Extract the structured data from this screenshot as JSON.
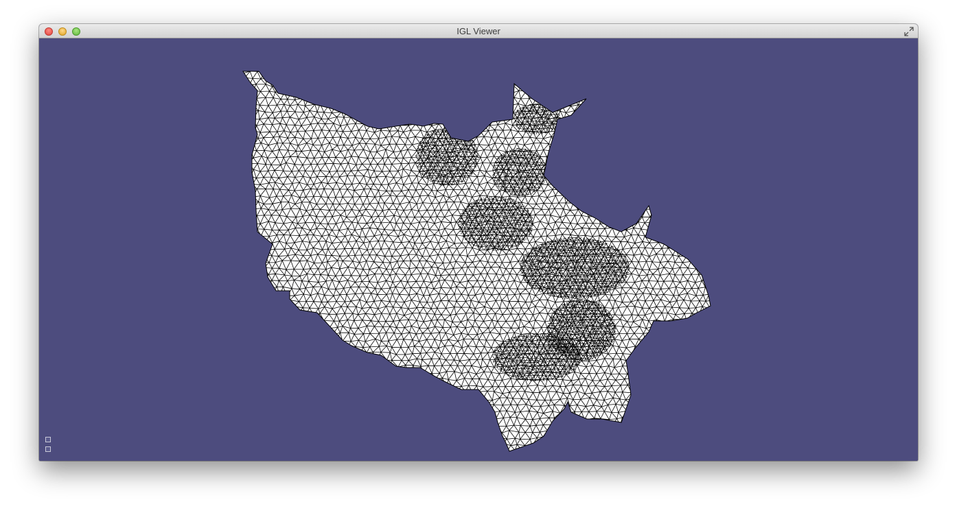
{
  "window": {
    "title": "IGL Viewer"
  },
  "titlebar_buttons": [
    "close",
    "minimize",
    "zoom"
  ],
  "viewport": {
    "background_color": "#4d4c7e",
    "mesh_fill_color": "#ffffff",
    "mesh_edge_color": "#000000",
    "content": "triangle-mesh-wireframe"
  },
  "corner_icons": [
    "view-icon",
    "settings-icon"
  ]
}
